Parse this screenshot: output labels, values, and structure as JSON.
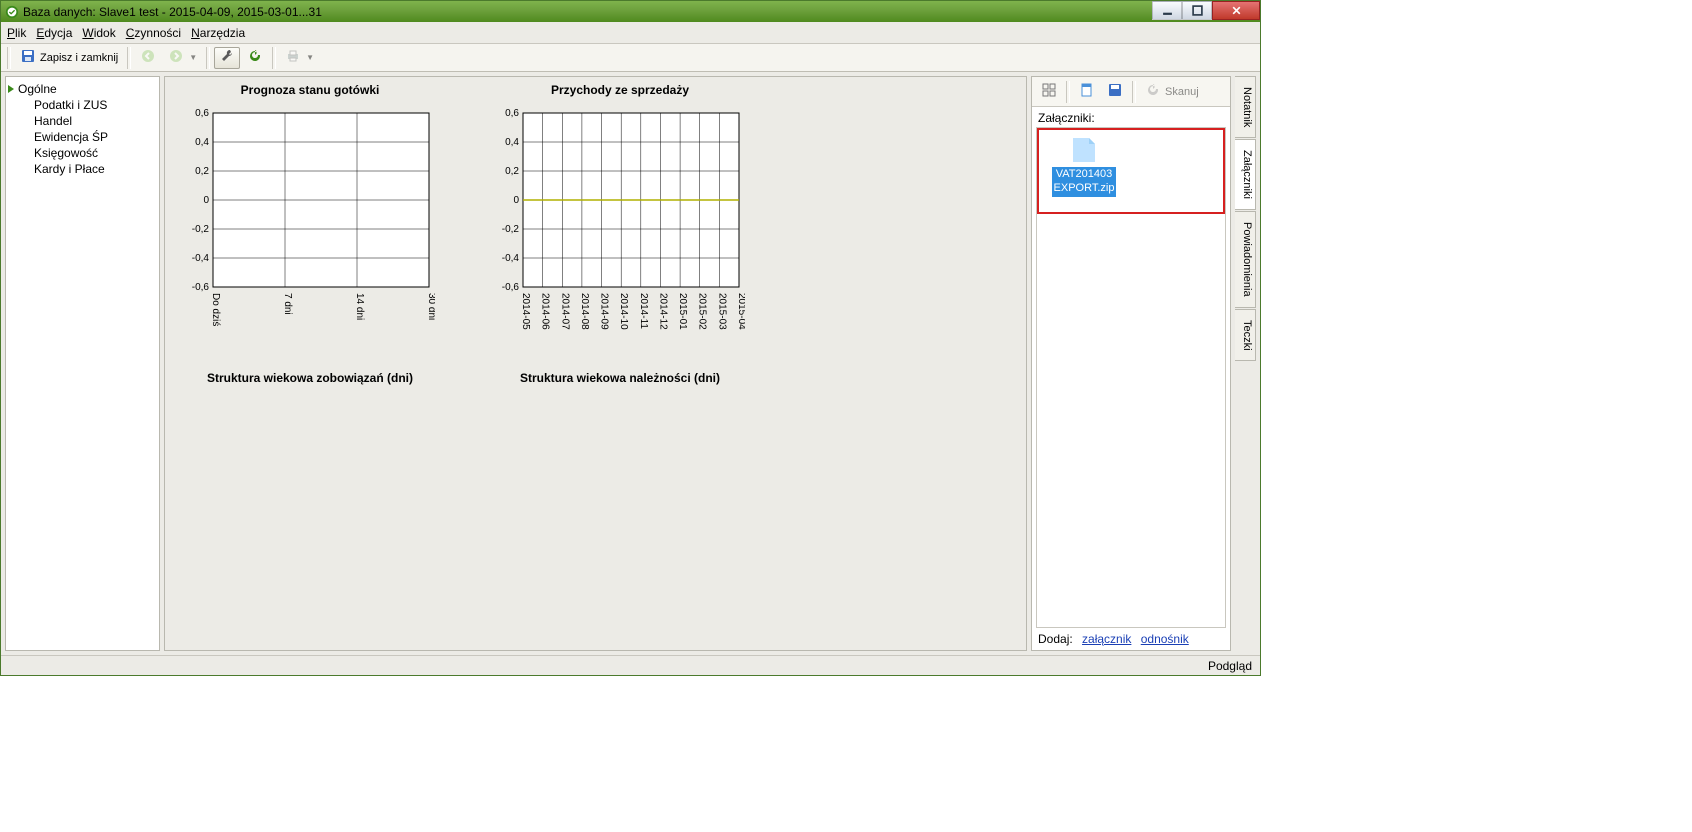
{
  "window": {
    "title": "Baza danych: Slave1 test - 2015-04-09, 2015-03-01...31"
  },
  "menu": {
    "items": [
      "Plik",
      "Edycja",
      "Widok",
      "Czynności",
      "Narzędzia"
    ]
  },
  "toolbar": {
    "save_close": "Zapisz i zamknij"
  },
  "nav": {
    "items": [
      {
        "label": "Ogólne",
        "selected": true
      },
      {
        "label": "Podatki i ZUS"
      },
      {
        "label": "Handel"
      },
      {
        "label": "Ewidencja ŚP"
      },
      {
        "label": "Księgowość"
      },
      {
        "label": "Kardy i Płace"
      }
    ]
  },
  "charts": {
    "row1": [
      {
        "title": "Prognoza stanu gotówki"
      },
      {
        "title": "Przychody ze sprzedaży"
      }
    ],
    "row2": [
      {
        "title": "Struktura wiekowa zobowiązań (dni)"
      },
      {
        "title": "Struktura wiekowa należności (dni)"
      }
    ]
  },
  "chart_data": [
    {
      "type": "line",
      "title": "Prognoza stanu gotówki",
      "categories": [
        "Do dziś",
        "7 dni",
        "14 dni",
        "30 dni"
      ],
      "series": [
        {
          "name": "",
          "values": [
            null,
            null,
            null,
            null
          ]
        }
      ],
      "ylim": [
        -0.6,
        0.6
      ],
      "yticks": [
        -0.6,
        -0.4,
        -0.2,
        0,
        0.2,
        0.4,
        0.6
      ]
    },
    {
      "type": "line",
      "title": "Przychody ze sprzedaży",
      "categories": [
        "2014-05",
        "2014-06",
        "2014-07",
        "2014-08",
        "2014-09",
        "2014-10",
        "2014-11",
        "2014-12",
        "2015-01",
        "2015-02",
        "2015-03",
        "2015-04"
      ],
      "series": [
        {
          "name": "",
          "values": [
            0,
            0,
            0,
            0,
            0,
            0,
            0,
            0,
            0,
            0,
            0,
            0
          ]
        }
      ],
      "ylim": [
        -0.6,
        0.6
      ],
      "yticks": [
        -0.6,
        -0.4,
        -0.2,
        0,
        0.2,
        0.4,
        0.6
      ]
    }
  ],
  "attachments": {
    "panel_label": "Załączniki:",
    "scan_label": "Skanuj",
    "files": [
      {
        "name_line1": "VAT201403",
        "name_line2": "EXPORT.zip"
      }
    ],
    "add_label": "Dodaj:",
    "add_link1": "załącznik",
    "add_link2": "odnośnik"
  },
  "righttabs": [
    "Notatnik",
    "Załączniki",
    "Powiadomienia",
    "Teczki"
  ],
  "statusbar": {
    "right": "Podgląd"
  }
}
